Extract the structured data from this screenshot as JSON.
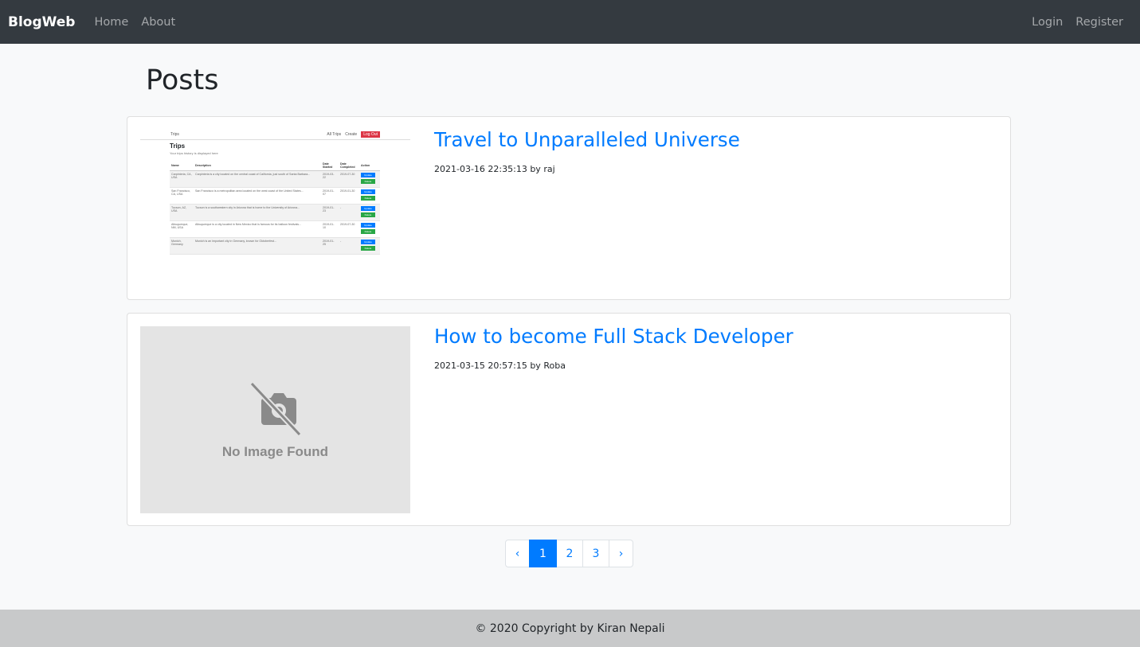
{
  "nav": {
    "brand": "BlogWeb",
    "links": [
      "Home",
      "About"
    ],
    "right_links": [
      "Login",
      "Register"
    ]
  },
  "page": {
    "title": "Posts"
  },
  "posts": [
    {
      "title": "Travel to Unparalleled Universe",
      "date": "2021-03-16 22:35:13",
      "by": "by",
      "author": "raj",
      "thumbnail": {
        "nav_title": "Trips",
        "nav_links": [
          "All Trips",
          "Create"
        ],
        "nav_button": "Log Out",
        "heading": "Trips",
        "subheading": "Your trips history is displayed here",
        "columns": [
          "Name",
          "Description",
          "Date Started",
          "Date Completed",
          "Action"
        ],
        "rows": [
          [
            "Carpinteria, CA, USA",
            "Carpinteria is a city located on the central coast of California, just south of Santa Barbara...",
            "2019-03-22",
            "2019-07-30"
          ],
          [
            "San Francisco, CA, USA",
            "San Francisco is a metropolitan area located on the west coast of the United States...",
            "2019-01-07",
            "2019-01-30"
          ],
          [
            "Tucson, AZ, USA",
            "Tucson is a southwestern city in Arizona that is home to the University of Arizona...",
            "2019-01-23",
            "-"
          ],
          [
            "Albuquerque, NM, USA",
            "Albuquerque is a city located in New Mexico that is famous for its balloon festivals...",
            "2019-01-10",
            "2019-07-30"
          ],
          [
            "Munich, Germany",
            "Munich is an important city in Germany, known for Oktoberfest...",
            "2019-01-25",
            "-"
          ]
        ],
        "update_label": "Update",
        "delete_label": "Delete"
      }
    },
    {
      "title": "How to become Full Stack Developer",
      "date": "2021-03-15 20:57:15",
      "by": "by",
      "author": "Roba",
      "placeholder_text": "No Image Found"
    }
  ],
  "pagination": {
    "prev": "‹",
    "pages": [
      "1",
      "2",
      "3"
    ],
    "next": "›",
    "current": "1"
  },
  "footer": {
    "text": "© 2020 Copyright by Kiran Nepali"
  },
  "colors": {
    "navbar": "#343a40",
    "link": "#007bff",
    "footer": "#c8c9ca"
  }
}
